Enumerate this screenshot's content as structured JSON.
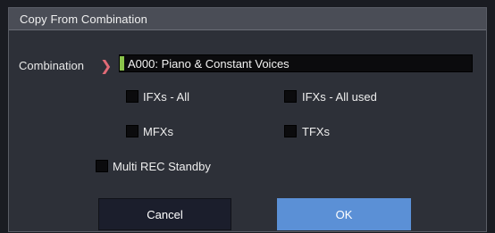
{
  "dialog": {
    "title": "Copy From Combination"
  },
  "combination": {
    "label": "Combination",
    "arrow": "❯",
    "value": "A000: Piano & Constant Voices"
  },
  "options": {
    "ifxs_all": "IFXs - All",
    "ifxs_all_used": "IFXs - All used",
    "mfxs": "MFXs",
    "tfxs": "TFXs",
    "multi_rec_standby": "Multi REC Standby"
  },
  "buttons": {
    "cancel": "Cancel",
    "ok": "OK"
  },
  "colors": {
    "accent_green": "#8ac34a",
    "arrow_red": "#e06a76",
    "ok_blue": "#5b90d6"
  }
}
